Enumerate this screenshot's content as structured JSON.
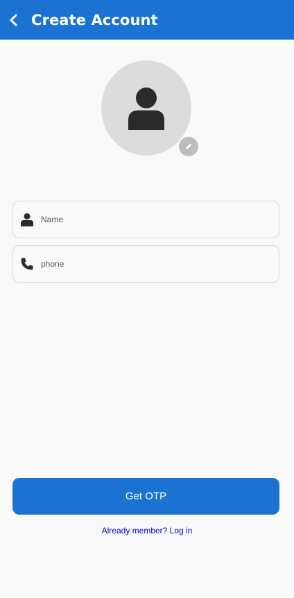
{
  "header": {
    "title": "Create Account",
    "back_icon": "chevron-left-icon"
  },
  "avatar": {
    "icon": "person-icon",
    "edit_icon": "pencil-icon",
    "bg_color": "#dcdcdc"
  },
  "form": {
    "name": {
      "placeholder": "Name",
      "value": "",
      "icon": "person-icon"
    },
    "phone": {
      "placeholder": "phone",
      "value": "",
      "icon": "phone-icon"
    }
  },
  "actions": {
    "get_otp_label": "Get OTP",
    "login_prompt": "Already member? Log in"
  },
  "colors": {
    "primary": "#1a73d2",
    "link": "#0000cc",
    "background": "#f9f9fa"
  }
}
